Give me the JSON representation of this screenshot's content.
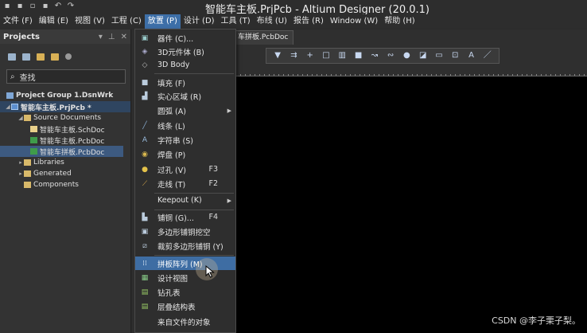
{
  "window": {
    "title": "智能车主板.PrjPcb - Altium Designer (20.0.1)"
  },
  "menubar": [
    "文件 (F)",
    "编辑 (E)",
    "视图 (V)",
    "工程 (C)",
    "放置 (P)",
    "设计 (D)",
    "工具 (T)",
    "布线 (U)",
    "报告 (R)",
    "Window (W)",
    "帮助 (H)"
  ],
  "projects_panel": {
    "title": "Projects",
    "search_placeholder": "查找",
    "tree": [
      {
        "label": "Project Group 1.DsnWrk",
        "icon": "workspace-icon"
      },
      {
        "label": "智能车主板.PrjPcb *",
        "icon": "project-icon"
      },
      {
        "label": "Source Documents",
        "icon": "folder-icon"
      },
      {
        "label": "智能车主板.SchDoc",
        "icon": "schematic-doc-icon"
      },
      {
        "label": "智能车主板.PcbDoc",
        "icon": "pcb-doc-icon"
      },
      {
        "label": "智能车拼板.PcbDoc",
        "icon": "pcb-doc-icon"
      },
      {
        "label": "Libraries",
        "icon": "folder-icon"
      },
      {
        "label": "Generated",
        "icon": "folder-icon"
      },
      {
        "label": "Components",
        "icon": "folder-icon"
      }
    ]
  },
  "document_tab": "车拼板.PcbDoc",
  "place_menu": {
    "items": [
      {
        "label": "器件 (C)...",
        "shortcut": "",
        "icon": "component-icon"
      },
      {
        "label": "3D元件体 (B)",
        "shortcut": "",
        "icon": "3d-body-icon"
      },
      {
        "label": "3D Body",
        "shortcut": "",
        "icon": "3d-body-alt-icon"
      },
      {
        "label": "填充 (F)",
        "shortcut": "",
        "icon": "fill-icon"
      },
      {
        "label": "实心区域 (R)",
        "shortcut": "",
        "icon": "solid-region-icon"
      },
      {
        "label": "圆弧 (A)",
        "shortcut": "",
        "icon": "arc-icon",
        "submenu": true
      },
      {
        "label": "线条 (L)",
        "shortcut": "",
        "icon": "line-icon"
      },
      {
        "label": "字符串 (S)",
        "shortcut": "",
        "icon": "string-icon"
      },
      {
        "label": "焊盘 (P)",
        "shortcut": "",
        "icon": "pad-icon"
      },
      {
        "label": "过孔 (V)",
        "shortcut": "F3",
        "icon": "via-icon"
      },
      {
        "label": "走线 (T)",
        "shortcut": "F2",
        "icon": "track-icon"
      },
      {
        "label": "Keepout (K)",
        "shortcut": "",
        "icon": "",
        "submenu": true
      },
      {
        "label": "铺铜 (G)...",
        "shortcut": "F4",
        "icon": "polygon-pour-icon"
      },
      {
        "label": "多边形铺铜挖空",
        "shortcut": "",
        "icon": "polygon-cutout-icon"
      },
      {
        "label": "裁剪多边形铺铜 (Y)",
        "shortcut": "",
        "icon": "slice-polygon-icon"
      },
      {
        "label": "拼板阵列 (M)",
        "shortcut": "",
        "icon": "embedded-board-array-icon"
      },
      {
        "label": "设计视图",
        "shortcut": "",
        "icon": "design-view-icon"
      },
      {
        "label": "钻孔表",
        "shortcut": "",
        "icon": "drill-table-icon"
      },
      {
        "label": "层叠结构表",
        "shortcut": "",
        "icon": "layer-stack-table-icon"
      },
      {
        "label": "来自文件的对象",
        "shortcut": "",
        "icon": ""
      }
    ]
  },
  "watermark": "CSDN @李子栗子梨。"
}
